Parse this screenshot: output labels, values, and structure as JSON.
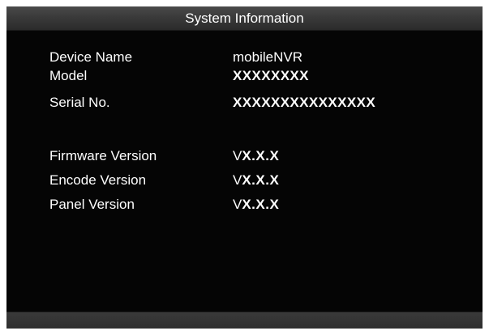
{
  "window": {
    "title": "System Information"
  },
  "device_info": {
    "device_name": {
      "label": "Device Name",
      "value": "mobileNVR"
    },
    "model": {
      "label": "Model",
      "value": "XXXXXXXX"
    },
    "serial_no": {
      "label": "Serial No.",
      "value": "XXXXXXXXXXXXXXX"
    }
  },
  "versions": {
    "firmware": {
      "label": "Firmware Version",
      "prefix": "V",
      "value": "X.X.X"
    },
    "encode": {
      "label": "Encode Version",
      "prefix": "V",
      "value": "X.X.X"
    },
    "panel": {
      "label": "Panel Version",
      "prefix": "V",
      "value": "X.X.X"
    }
  },
  "colors": {
    "background": "#050505",
    "title_bar": "#3a3a3a",
    "text": "#ffffff",
    "page": "#ffffff"
  }
}
